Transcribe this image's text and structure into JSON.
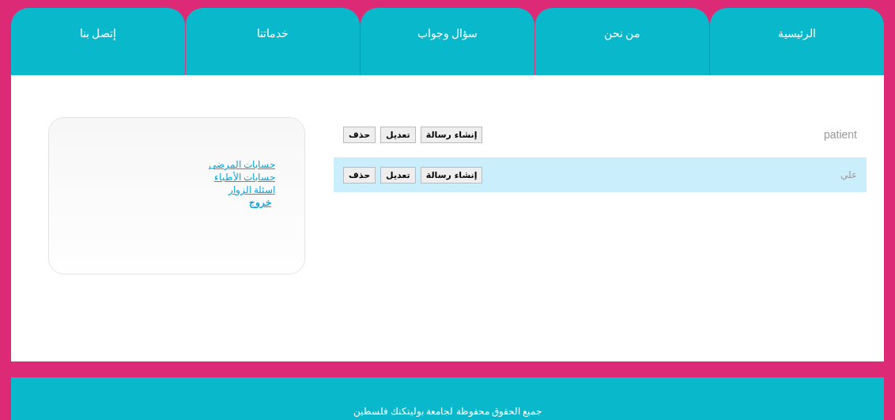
{
  "nav": [
    {
      "label": "الرئيسية"
    },
    {
      "label": "من نحن"
    },
    {
      "label": "سؤال وجواب"
    },
    {
      "label": "خدماتنا"
    },
    {
      "label": "إتصل بنا"
    }
  ],
  "rows": [
    {
      "name": "patient",
      "selected": false,
      "buttons": [
        "إنشاء رسالة",
        "تعديل",
        "حذف"
      ]
    },
    {
      "name": "علي",
      "selected": true,
      "buttons": [
        "إنشاء رسالة",
        "تعديل",
        "حذف"
      ]
    }
  ],
  "side_links": [
    {
      "label": "حسابات المرضى",
      "bold": false
    },
    {
      "label": "حسابات الأطباء",
      "bold": false
    },
    {
      "label": "اسئلة الزوار",
      "bold": false
    },
    {
      "label": "خروج",
      "bold": true
    }
  ],
  "footer": "جميع الحقوق محفوظة لجامعة بوليتكنك فلسطين"
}
